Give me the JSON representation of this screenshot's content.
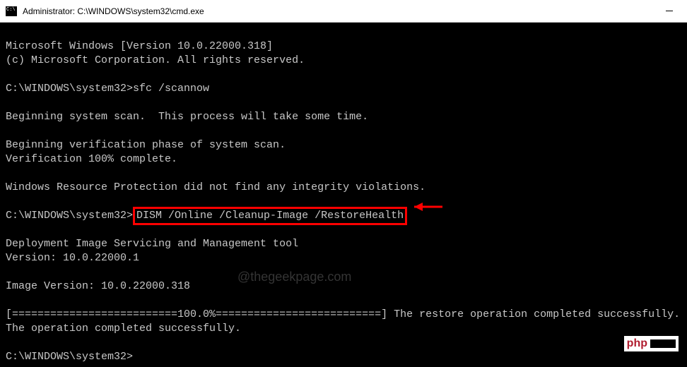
{
  "titlebar": {
    "title": "Administrator: C:\\WINDOWS\\system32\\cmd.exe"
  },
  "terminal": {
    "line1": "Microsoft Windows [Version 10.0.22000.318]",
    "line2": "(c) Microsoft Corporation. All rights reserved.",
    "blank1": "",
    "prompt1_path": "C:\\WINDOWS\\system32>",
    "prompt1_cmd": "sfc /scannow",
    "blank2": "",
    "line3": "Beginning system scan.  This process will take some time.",
    "blank3": "",
    "line4": "Beginning verification phase of system scan.",
    "line5": "Verification 100% complete.",
    "blank4": "",
    "line6": "Windows Resource Protection did not find any integrity violations.",
    "blank5": "",
    "prompt2_path": "C:\\WINDOWS\\system32>",
    "prompt2_cmd": "DISM /Online /Cleanup-Image /RestoreHealth",
    "blank6": "",
    "line7": "Deployment Image Servicing and Management tool",
    "line8": "Version: 10.0.22000.1",
    "blank7": "",
    "line9": "Image Version: 10.0.22000.318",
    "blank8": "",
    "line10": "[==========================100.0%==========================] The restore operation completed successfully.",
    "line11": "The operation completed successfully.",
    "blank9": "",
    "prompt3_path": "C:\\WINDOWS\\system32>",
    "prompt3_cmd": ""
  },
  "watermark": "@thegeekpage.com",
  "badge": {
    "text": "php"
  }
}
